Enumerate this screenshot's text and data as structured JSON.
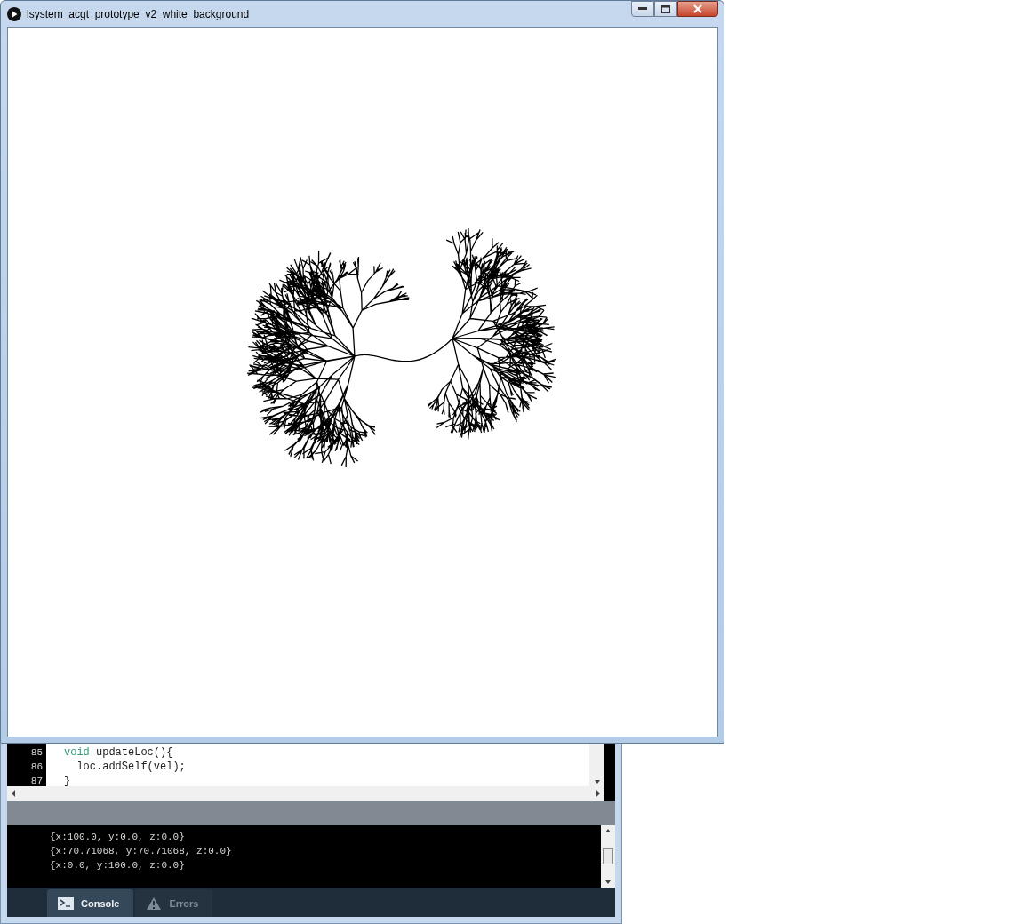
{
  "sketch_window": {
    "title": "lsystem_acgt_prototype_v2_white_background"
  },
  "editor": {
    "lines": [
      {
        "number": "85",
        "tokens": [
          {
            "kind": "keyword",
            "text": "void"
          },
          {
            "kind": "plain",
            "text": " updateLoc(){"
          }
        ]
      },
      {
        "number": "86",
        "tokens": [
          {
            "kind": "plain",
            "text": "  loc.addSelf(vel);"
          }
        ]
      },
      {
        "number": "87",
        "tokens": [
          {
            "kind": "plain",
            "text": "}"
          }
        ]
      }
    ]
  },
  "console": {
    "lines": [
      "{x:100.0, y:0.0, z:0.0}",
      "{x:70.71068, y:70.71068, z:0.0}",
      "{x:0.0, y:100.0, z:0.0}"
    ]
  },
  "tabs": [
    {
      "kind": "console",
      "label": "Console",
      "selected": true
    },
    {
      "kind": "errors",
      "label": "Errors",
      "selected": false
    }
  ]
}
